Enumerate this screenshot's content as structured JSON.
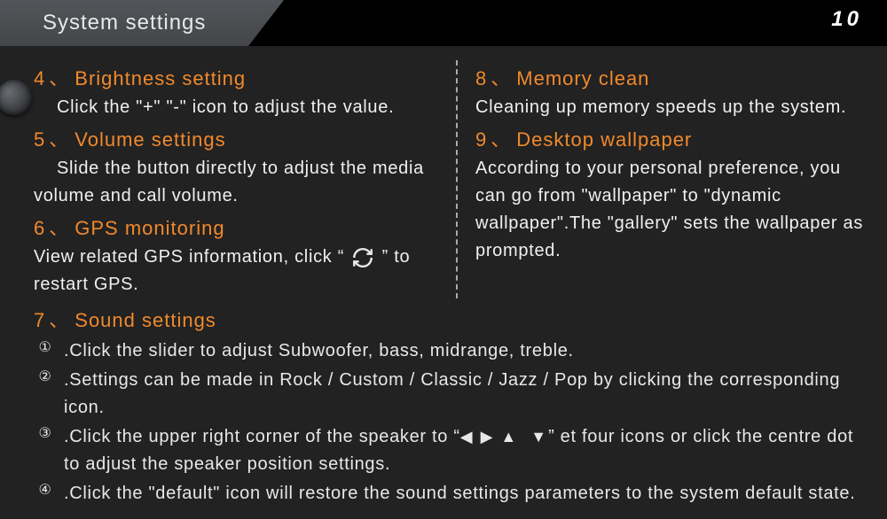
{
  "header": {
    "title": "System settings"
  },
  "page_number": "10",
  "left": [
    {
      "num": "4",
      "title": "Brightness setting",
      "body": "Click the \"+\" \"-\" icon to adjust the value."
    },
    {
      "num": "5",
      "title": "Volume settings",
      "body": "Slide the button directly to adjust the media volume and call volume."
    },
    {
      "num": "6",
      "title": "GPS monitoring",
      "body_before": "View related GPS information, click “",
      "body_after": "” to restart GPS."
    }
  ],
  "right": [
    {
      "num": "8",
      "title": "Memory clean",
      "body": "Cleaning up memory speeds up the system."
    },
    {
      "num": "9",
      "title": "Desktop wallpaper",
      "body": "According to your personal preference, you can go from \"wallpaper\" to \"dynamic wallpaper\".The \"gallery\" sets the wallpaper as prompted."
    }
  ],
  "sound": {
    "num": "7",
    "title": "Sound settings",
    "items": [
      "Click the slider to adjust Subwoofer, bass, midrange, treble.",
      "Settings can be made in Rock / Custom / Classic / Jazz / Pop by clicking the corresponding icon.",
      {
        "before": "Click the upper right corner of the speaker to “",
        "icons": "◀ ▶ ▲  ▼",
        "after": "” et four icons or click the centre dot to adjust the speaker position settings."
      },
      "Click the \"default\" icon will restore the sound settings parameters to the system default state."
    ],
    "circled": [
      "①",
      "②",
      "③",
      "④"
    ]
  }
}
